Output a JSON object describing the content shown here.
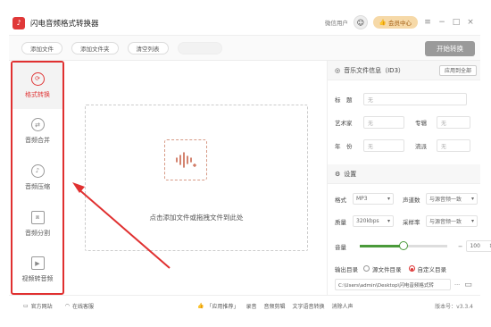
{
  "app": {
    "title": "闪电音频格式转换器",
    "wechat_user": "微信用户",
    "vip": "会员中心",
    "window_min": "−",
    "window_max": "□",
    "window_close": "×",
    "menu": "≡"
  },
  "toolbar": {
    "add_file": "添加文件",
    "add_folder": "添加文件夹",
    "clear_list": "清空列表",
    "start_convert": "开始转换"
  },
  "sidebar": {
    "items": [
      {
        "label": "格式转换",
        "icon": "⟳"
      },
      {
        "label": "音频合并",
        "icon": "⇄"
      },
      {
        "label": "音频压缩",
        "icon": "♪"
      },
      {
        "label": "音频分割",
        "icon": "⧈"
      },
      {
        "label": "视频转音频",
        "icon": "▶"
      }
    ]
  },
  "dropzone": {
    "text": "点击添加文件或拖拽文件到此处"
  },
  "music_info": {
    "title": "音乐文件信息（ID3）",
    "apply_all": "应用到全部",
    "title_label": "标　题",
    "artist_label": "艺术家",
    "album_label": "专辑",
    "year_label": "年　份",
    "genre_label": "流派",
    "none": "无"
  },
  "settings": {
    "title": "设置",
    "format_label": "格式",
    "format_value": "MP3",
    "channels_label": "声道数",
    "channels_value": "与源音频一致",
    "quality_label": "质量",
    "quality_value": "320kbps",
    "samplerate_label": "采样率",
    "samplerate_value": "与源音频一致",
    "volume_label": "音量",
    "volume_value": "100",
    "volume_fraction": 0.5,
    "output_label": "输出目录",
    "option_source": "源文件目录",
    "option_custom": "自定义目录",
    "output_path": "C:\\Users\\admin\\Desktop\\闪电音频格式转",
    "more": "···"
  },
  "status": {
    "website": "官方网站",
    "support": "在线客服",
    "recommend_label": "「应用推荐」",
    "apps": [
      "录音",
      "音频剪辑",
      "文字语音转换",
      "消除人声"
    ],
    "version": "版本号：v3.3.4"
  },
  "colors": {
    "accent": "#e03838",
    "annotation": "#e03030"
  }
}
